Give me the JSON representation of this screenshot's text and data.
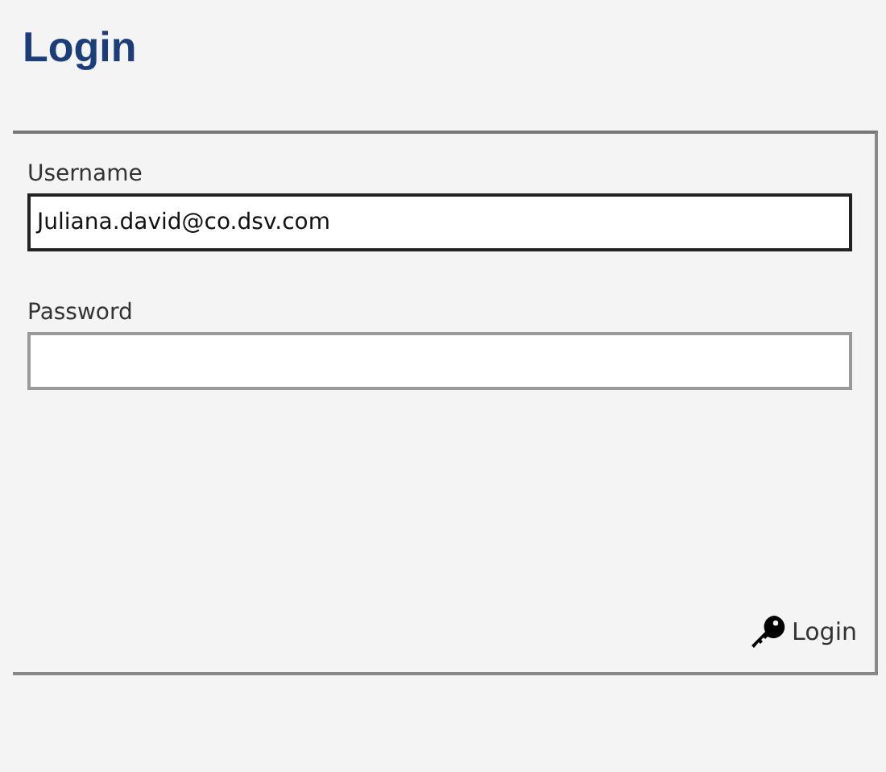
{
  "title": "Login",
  "fields": [
    {
      "label": "Username",
      "value": "Juliana.david@co.dsv.com",
      "focused": true
    },
    {
      "label": "Password",
      "focused": false
    }
  ],
  "button": {
    "label": "Login"
  }
}
